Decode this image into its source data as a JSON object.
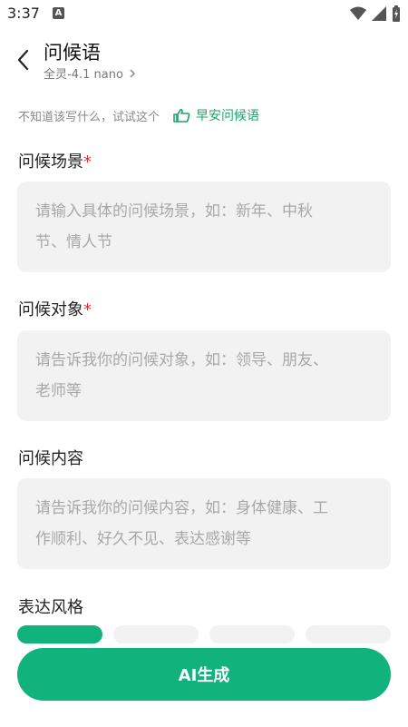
{
  "status": {
    "time": "3:37",
    "app_badge": "A"
  },
  "header": {
    "title": "问候语",
    "subtitle": "全灵-4.1 nano"
  },
  "hint": {
    "text": "不知道该写什么，试试这个",
    "link": "早安问候语"
  },
  "fields": [
    {
      "label": "问候场景",
      "required": "*",
      "placeholder_line1": "请输入具体的问候场景，如：新年、中秋",
      "placeholder_line2": "节、情人节"
    },
    {
      "label": "问候对象",
      "required": "*",
      "placeholder_line1": "请告诉我你的问候对象，如：领导、朋友、",
      "placeholder_line2": "老师等"
    },
    {
      "label": "问候内容",
      "required": "",
      "placeholder_line1": "请告诉我你的问候内容，如：身体健康、工",
      "placeholder_line2": "作顺利、好久不见、表达感谢等"
    }
  ],
  "style": {
    "label": "表达风格"
  },
  "button": {
    "label": "AI生成"
  },
  "colors": {
    "accent": "#12b27c",
    "required": "#e03131"
  }
}
